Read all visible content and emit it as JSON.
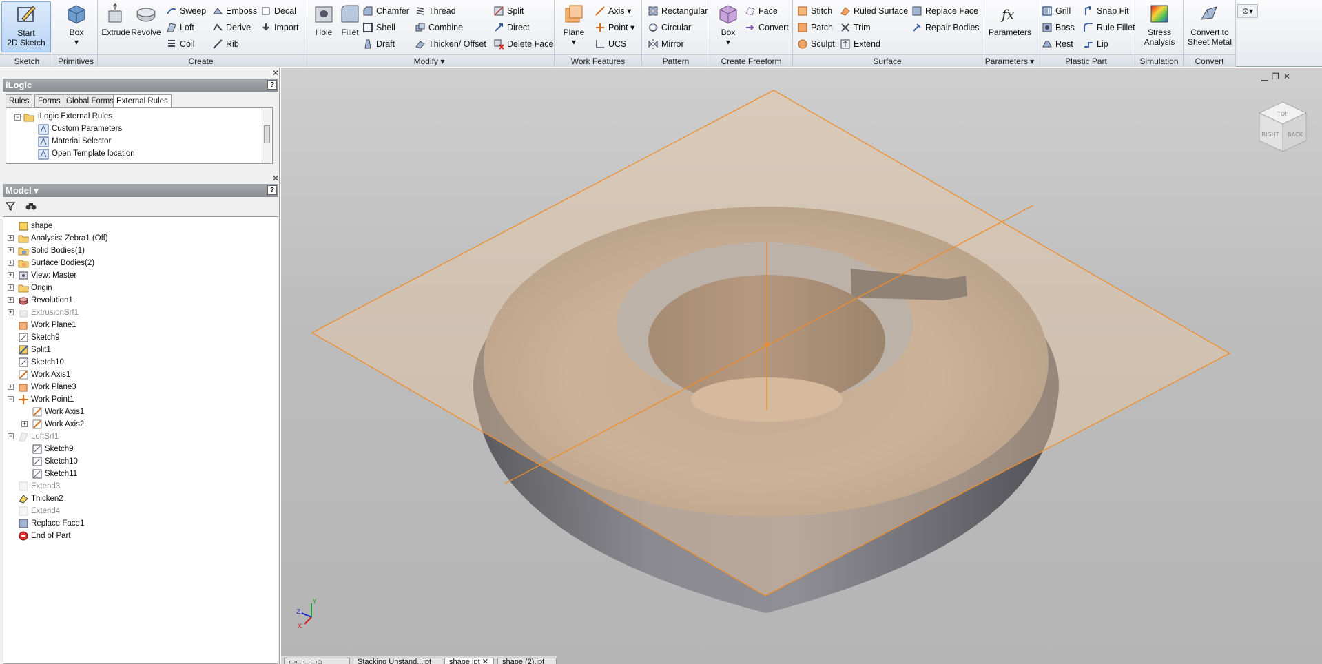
{
  "ribbon": {
    "panels": [
      "Sketch",
      "Primitives",
      "Create",
      "Modify",
      "Work Features",
      "Pattern",
      "Create Freeform",
      "Surface",
      "Parameters",
      "Plastic Part",
      "Simulation",
      "Convert"
    ],
    "sketch": {
      "start_line1": "Start",
      "start_line2": "2D Sketch"
    },
    "primitives": {
      "box": "Box"
    },
    "create": {
      "extrude": "Extrude",
      "revolve": "Revolve",
      "sweep": "Sweep",
      "loft": "Loft",
      "coil": "Coil",
      "emboss": "Emboss",
      "derive": "Derive",
      "rib": "Rib",
      "decal": "Decal",
      "import": "Import"
    },
    "modify": {
      "hole": "Hole",
      "fillet": "Fillet",
      "chamfer": "Chamfer",
      "shell": "Shell",
      "draft": "Draft",
      "thread": "Thread",
      "combine": "Combine",
      "thicken": "Thicken/ Offset",
      "split": "Split",
      "direct": "Direct",
      "delete_face": "Delete Face"
    },
    "work": {
      "plane": "Plane",
      "axis": "Axis",
      "point": "Point",
      "ucs": "UCS"
    },
    "pattern": {
      "rectangular": "Rectangular",
      "circular": "Circular",
      "mirror": "Mirror"
    },
    "freeform": {
      "box": "Box",
      "face": "Face",
      "convert": "Convert"
    },
    "surface": {
      "stitch": "Stitch",
      "patch": "Patch",
      "sculpt": "Sculpt",
      "ruled": "Ruled Surface",
      "trim": "Trim",
      "extend": "Extend",
      "replace": "Replace Face",
      "repair": "Repair Bodies"
    },
    "parameters": {
      "label": "Parameters"
    },
    "plastic": {
      "grill": "Grill",
      "boss": "Boss",
      "rest": "Rest",
      "snap": "Snap Fit",
      "rulefillet": "Rule Fillet",
      "lip": "Lip"
    },
    "simulation": {
      "line1": "Stress",
      "line2": "Analysis"
    },
    "convert": {
      "line1": "Convert to",
      "line2": "Sheet Metal"
    }
  },
  "ilogic": {
    "title": "iLogic",
    "tabs": [
      "Rules",
      "Forms",
      "Global Forms",
      "External Rules"
    ],
    "active_tab": "External Rules",
    "items": [
      "iLogic External Rules",
      "Custom Parameters",
      "Material Selector",
      "Open Template location"
    ]
  },
  "model": {
    "title": "Model",
    "nodes": [
      "shape",
      "Analysis: Zebra1 (Off)",
      "Solid Bodies(1)",
      "Surface Bodies(2)",
      "View: Master",
      "Origin",
      "Revolution1",
      "ExtrusionSrf1",
      "Work Plane1",
      "Sketch9",
      "Split1",
      "Sketch10",
      "Work Axis1",
      "Work Plane3",
      "Work Point1",
      "Work Axis1",
      "Work Axis2",
      "LoftSrf1",
      "Sketch9",
      "Sketch10",
      "Sketch11",
      "Extend3",
      "Thicken2",
      "Extend4",
      "Replace Face1",
      "End of Part"
    ]
  },
  "viewcube": {
    "left": "RIGHT",
    "right": "BACK",
    "top": "TOP"
  },
  "triad": {
    "x": "X",
    "y": "Y",
    "z": "Z"
  },
  "doc_tabs": [
    "Stacking Unstand...ipt",
    "shape.ipt",
    "shape (2).ipt"
  ],
  "colors": {
    "accent": "#f08c28",
    "plane": "#e8c8a4",
    "body": "#9b8a7a"
  }
}
